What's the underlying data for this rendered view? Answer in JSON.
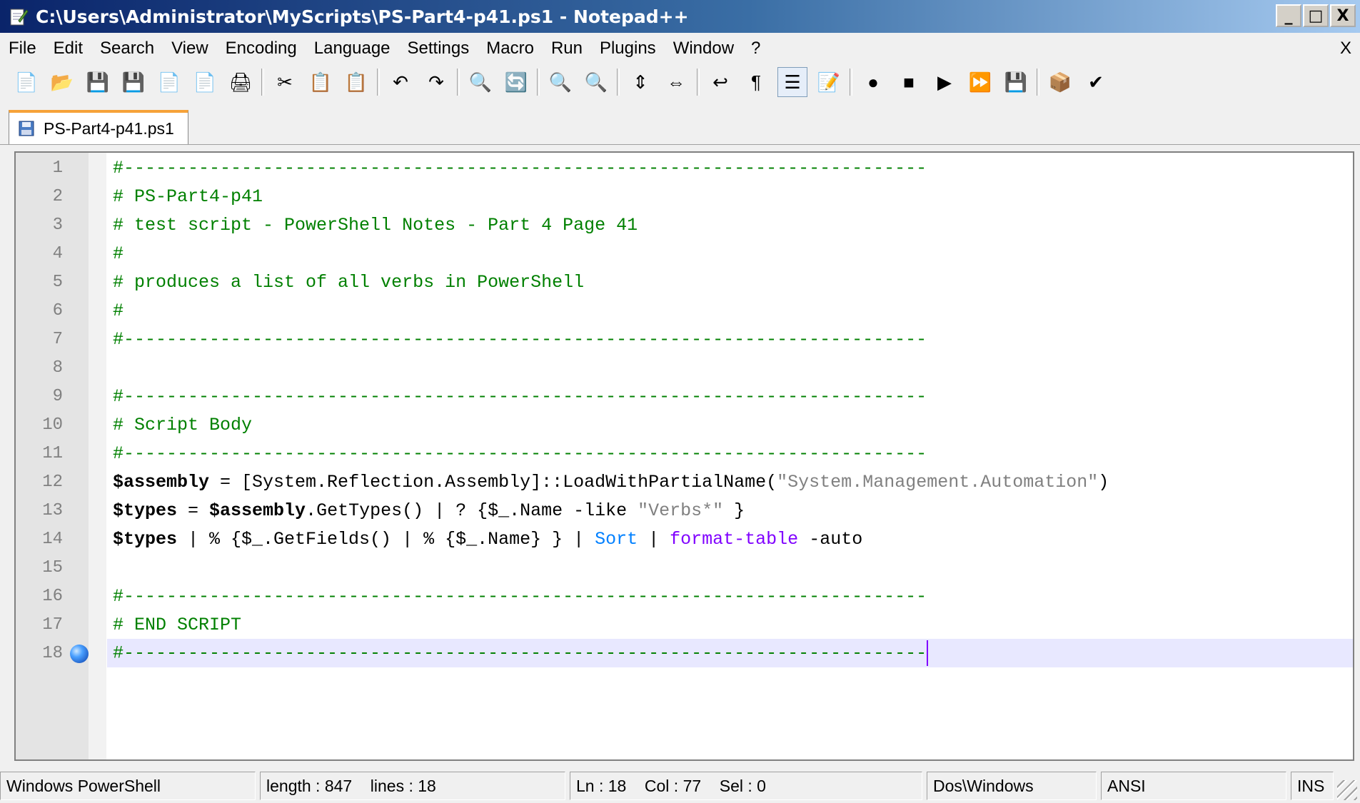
{
  "window": {
    "title": "C:\\Users\\Administrator\\MyScripts\\PS-Part4-p41.ps1 - Notepad++",
    "minimize": "_",
    "maximize": "□",
    "close": "X"
  },
  "menu": {
    "items": [
      "File",
      "Edit",
      "Search",
      "View",
      "Encoding",
      "Language",
      "Settings",
      "Macro",
      "Run",
      "Plugins",
      "Window",
      "?"
    ],
    "close_doc": "X"
  },
  "toolbar": {
    "buttons": [
      {
        "icon": "new-file-icon",
        "glyph": "📄"
      },
      {
        "icon": "open-file-icon",
        "glyph": "📂"
      },
      {
        "icon": "save-icon",
        "glyph": "💾"
      },
      {
        "icon": "save-all-icon",
        "glyph": "💾"
      },
      {
        "icon": "close-icon",
        "glyph": "📄"
      },
      {
        "icon": "close-all-icon",
        "glyph": "📄"
      },
      {
        "icon": "print-icon",
        "glyph": "🖨"
      },
      {
        "sep": true
      },
      {
        "icon": "cut-icon",
        "glyph": "✂"
      },
      {
        "icon": "copy-icon",
        "glyph": "📋"
      },
      {
        "icon": "paste-icon",
        "glyph": "📋"
      },
      {
        "sep": true
      },
      {
        "icon": "undo-icon",
        "glyph": "↶"
      },
      {
        "icon": "redo-icon",
        "glyph": "↷"
      },
      {
        "sep": true
      },
      {
        "icon": "find-icon",
        "glyph": "🔍"
      },
      {
        "icon": "replace-icon",
        "glyph": "🔄"
      },
      {
        "sep": true
      },
      {
        "icon": "zoom-in-icon",
        "glyph": "🔍"
      },
      {
        "icon": "zoom-out-icon",
        "glyph": "🔍"
      },
      {
        "sep": true
      },
      {
        "icon": "sync-vertical-icon",
        "glyph": "⇕"
      },
      {
        "icon": "sync-horizontal-icon",
        "glyph": "⇔"
      },
      {
        "sep": true
      },
      {
        "icon": "word-wrap-icon",
        "glyph": "↩"
      },
      {
        "icon": "show-all-chars-icon",
        "glyph": "¶"
      },
      {
        "icon": "indent-guide-icon",
        "glyph": "☰",
        "pressed": true
      },
      {
        "icon": "language-icon",
        "glyph": "📝"
      },
      {
        "sep": true
      },
      {
        "icon": "record-macro-icon",
        "glyph": "●"
      },
      {
        "icon": "stop-macro-icon",
        "glyph": "■"
      },
      {
        "icon": "play-macro-icon",
        "glyph": "▶"
      },
      {
        "icon": "run-macro-multiple-icon",
        "glyph": "⏩"
      },
      {
        "icon": "save-macro-icon",
        "glyph": "💾"
      },
      {
        "sep": true
      },
      {
        "icon": "plugin-icon",
        "glyph": "📦"
      },
      {
        "icon": "spell-check-icon",
        "glyph": "✔"
      }
    ]
  },
  "tab": {
    "label": "PS-Part4-p41.ps1"
  },
  "editor": {
    "lines": [
      {
        "n": "1",
        "tokens": [
          {
            "t": "#---------------------------------------------------------------------------",
            "c": "c"
          }
        ]
      },
      {
        "n": "2",
        "tokens": [
          {
            "t": "# PS-Part4-p41",
            "c": "c"
          }
        ]
      },
      {
        "n": "3",
        "tokens": [
          {
            "t": "# test script - PowerShell Notes - Part 4 Page 41",
            "c": "c"
          }
        ]
      },
      {
        "n": "4",
        "tokens": [
          {
            "t": "#",
            "c": "c"
          }
        ]
      },
      {
        "n": "5",
        "tokens": [
          {
            "t": "# produces a list of all verbs in PowerShell",
            "c": "c"
          }
        ]
      },
      {
        "n": "6",
        "tokens": [
          {
            "t": "#",
            "c": "c"
          }
        ]
      },
      {
        "n": "7",
        "tokens": [
          {
            "t": "#---------------------------------------------------------------------------",
            "c": "c"
          }
        ]
      },
      {
        "n": "8",
        "tokens": []
      },
      {
        "n": "9",
        "tokens": [
          {
            "t": "#---------------------------------------------------------------------------",
            "c": "c"
          }
        ]
      },
      {
        "n": "10",
        "tokens": [
          {
            "t": "# Script Body",
            "c": "c"
          }
        ]
      },
      {
        "n": "11",
        "tokens": [
          {
            "t": "#---------------------------------------------------------------------------",
            "c": "c"
          }
        ]
      },
      {
        "n": "12",
        "tokens": [
          {
            "t": "$assembly",
            "c": "v"
          },
          {
            "t": " = [System.Reflection.Assembly]::LoadWithPartialName(",
            "c": ""
          },
          {
            "t": "\"System.Management.Automation\"",
            "c": "s"
          },
          {
            "t": ")",
            "c": ""
          }
        ]
      },
      {
        "n": "13",
        "tokens": [
          {
            "t": "$types",
            "c": "v"
          },
          {
            "t": " = ",
            "c": ""
          },
          {
            "t": "$assembly",
            "c": "v"
          },
          {
            "t": ".GetTypes() | ? {$_.Name -like ",
            "c": ""
          },
          {
            "t": "\"Verbs*\"",
            "c": "s"
          },
          {
            "t": " }",
            "c": ""
          }
        ]
      },
      {
        "n": "14",
        "tokens": [
          {
            "t": "$types",
            "c": "v"
          },
          {
            "t": " | % {$_.GetFields() | % {$_.Name} } | ",
            "c": ""
          },
          {
            "t": "Sort",
            "c": "cm"
          },
          {
            "t": " | ",
            "c": ""
          },
          {
            "t": "format-table",
            "c": "pp"
          },
          {
            "t": " -auto",
            "c": ""
          }
        ]
      },
      {
        "n": "15",
        "tokens": []
      },
      {
        "n": "16",
        "tokens": [
          {
            "t": "#---------------------------------------------------------------------------",
            "c": "c"
          }
        ]
      },
      {
        "n": "17",
        "tokens": [
          {
            "t": "# END SCRIPT",
            "c": "c"
          }
        ]
      },
      {
        "n": "18",
        "tokens": [
          {
            "t": "#---------------------------------------------------------------------------",
            "c": "c"
          }
        ],
        "active": true,
        "bookmark": true
      }
    ]
  },
  "status": {
    "language": "Windows PowerShell",
    "length_lines": "length : 847    lines : 18",
    "position": "Ln : 18    Col : 77    Sel : 0",
    "eol": "Dos\\Windows",
    "encoding": "ANSI",
    "mode": "INS"
  }
}
